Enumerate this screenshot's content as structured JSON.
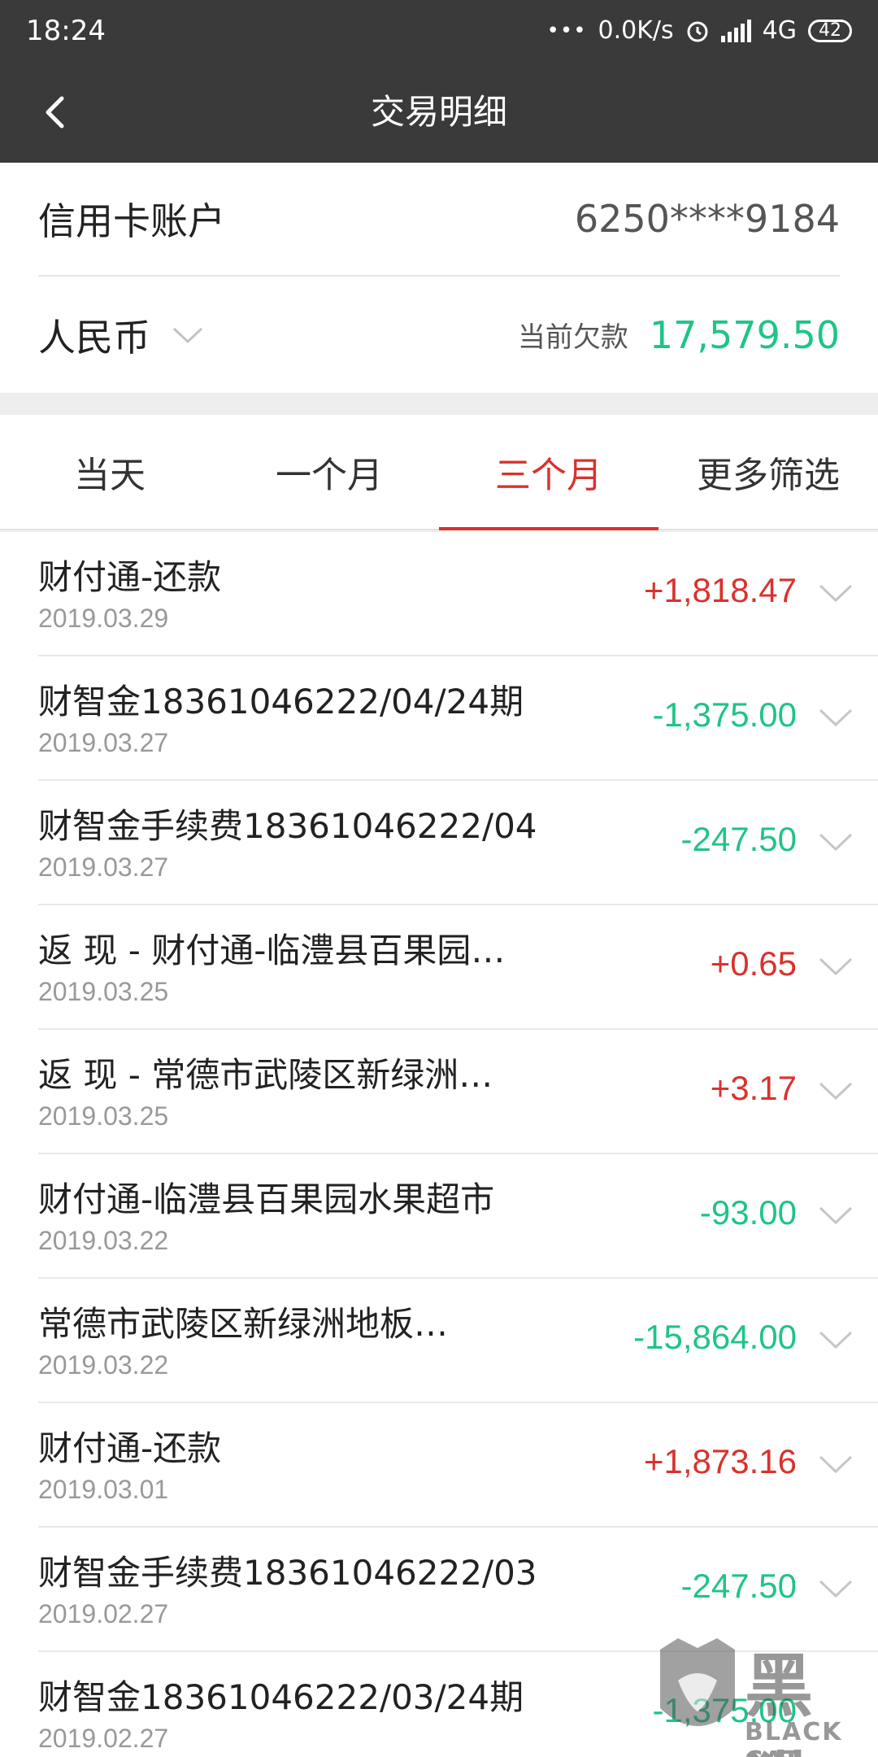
{
  "status": {
    "time": "18:24",
    "network_speed": "0.0K/s",
    "network_type": "4G",
    "battery": "42"
  },
  "nav": {
    "title": "交易明细"
  },
  "account": {
    "label": "信用卡账户",
    "number": "6250****9184",
    "currency": "人民币",
    "debt_label": "当前欠款",
    "debt_value": "17,579.50"
  },
  "tabs": [
    {
      "label": "当天",
      "active": false
    },
    {
      "label": "一个月",
      "active": false
    },
    {
      "label": "三个月",
      "active": true
    },
    {
      "label": "更多筛选",
      "active": false
    }
  ],
  "transactions": [
    {
      "name": "财付通-还款",
      "date": "2019.03.29",
      "amount": "+1,818.47",
      "sign": "pos"
    },
    {
      "name": "财智金18361046222/04/24期",
      "date": "2019.03.27",
      "amount": "-1,375.00",
      "sign": "neg"
    },
    {
      "name": "财智金手续费18361046222/04",
      "date": "2019.03.27",
      "amount": "-247.50",
      "sign": "neg"
    },
    {
      "name": "返 现 - 财付通-临澧县百果园…",
      "date": "2019.03.25",
      "amount": "+0.65",
      "sign": "pos"
    },
    {
      "name": "返 现 - 常德市武陵区新绿洲…",
      "date": "2019.03.25",
      "amount": "+3.17",
      "sign": "pos"
    },
    {
      "name": "财付通-临澧县百果园水果超市",
      "date": "2019.03.22",
      "amount": "-93.00",
      "sign": "neg"
    },
    {
      "name": "常德市武陵区新绿洲地板…",
      "date": "2019.03.22",
      "amount": "-15,864.00",
      "sign": "neg"
    },
    {
      "name": "财付通-还款",
      "date": "2019.03.01",
      "amount": "+1,873.16",
      "sign": "pos"
    },
    {
      "name": "财智金手续费18361046222/03",
      "date": "2019.02.27",
      "amount": "-247.50",
      "sign": "neg"
    },
    {
      "name": "财智金18361046222/03/24期",
      "date": "2019.02.27",
      "amount": "-1,375.00",
      "sign": "neg"
    }
  ],
  "watermark": {
    "text": "黑猫",
    "sub": "BLACK CAT"
  },
  "colors": {
    "positive": "#d9322e",
    "negative": "#1fc486",
    "header": "#3a3a3a",
    "active_tab": "#d9322e"
  }
}
